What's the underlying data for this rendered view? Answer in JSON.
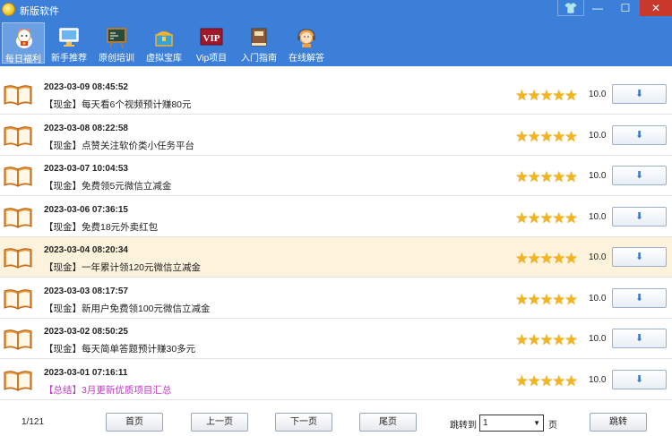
{
  "window": {
    "title": "新版软件",
    "controls": {
      "skin": "👕",
      "minimize": "—",
      "maximize": "☐",
      "close": "✕"
    }
  },
  "toolbar": {
    "items": [
      {
        "label": "每日福利",
        "icon": "lucky-cat-icon",
        "active": true
      },
      {
        "label": "新手推荐",
        "icon": "monitor-icon",
        "active": false
      },
      {
        "label": "原创培训",
        "icon": "blackboard-icon",
        "active": false
      },
      {
        "label": "虚拟宝库",
        "icon": "treasure-chest-icon",
        "active": false
      },
      {
        "label": "Vip项目",
        "icon": "vip-icon",
        "active": false,
        "icon_text": "VIP"
      },
      {
        "label": "入门指南",
        "icon": "guide-book-icon",
        "active": false
      },
      {
        "label": "在线解答",
        "icon": "support-agent-icon",
        "active": false
      }
    ]
  },
  "list": {
    "rows": [
      {
        "date": "2023-03-09 08:45:52",
        "title": "【现金】每天看6个视频预计赚80元",
        "rating": 5,
        "score": "10.0",
        "type": "cash"
      },
      {
        "date": "2023-03-08 08:22:58",
        "title": "【现金】点赞关注软价类小任务平台",
        "rating": 5,
        "score": "10.0",
        "type": "cash"
      },
      {
        "date": "2023-03-07 10:04:53",
        "title": "【现金】免费领5元微信立减金",
        "rating": 5,
        "score": "10.0",
        "type": "cash"
      },
      {
        "date": "2023-03-06 07:36:15",
        "title": "【现金】免费18元外卖红包",
        "rating": 5,
        "score": "10.0",
        "type": "cash"
      },
      {
        "date": "2023-03-04 08:20:34",
        "title": "【现金】一年累计领120元微信立减金",
        "rating": 5,
        "score": "10.0",
        "type": "cash",
        "highlight": true
      },
      {
        "date": "2023-03-03 08:17:57",
        "title": "【现金】新用户免费领100元微信立减金",
        "rating": 5,
        "score": "10.0",
        "type": "cash"
      },
      {
        "date": "2023-03-02 08:50:25",
        "title": "【现金】每天简单答题预计赚30多元",
        "rating": 5,
        "score": "10.0",
        "type": "cash"
      },
      {
        "date": "2023-03-01 07:16:11",
        "title": "【总结】3月更新优质项目汇总",
        "rating": 5,
        "score": "10.0",
        "type": "summary"
      }
    ],
    "download_icon": "⬇"
  },
  "pagination": {
    "page_count": "1/121",
    "first": "首页",
    "prev": "上一页",
    "next": "下一页",
    "last": "尾页",
    "jump_label": "跳转到",
    "jump_value": "1",
    "page_unit": "页",
    "jump_button": "跳转"
  },
  "colors": {
    "titlebar": "#3b7fd8",
    "star": "#f3b51d",
    "highlight_row": "#fdf3dc",
    "summary_text": "#c03ac0"
  }
}
